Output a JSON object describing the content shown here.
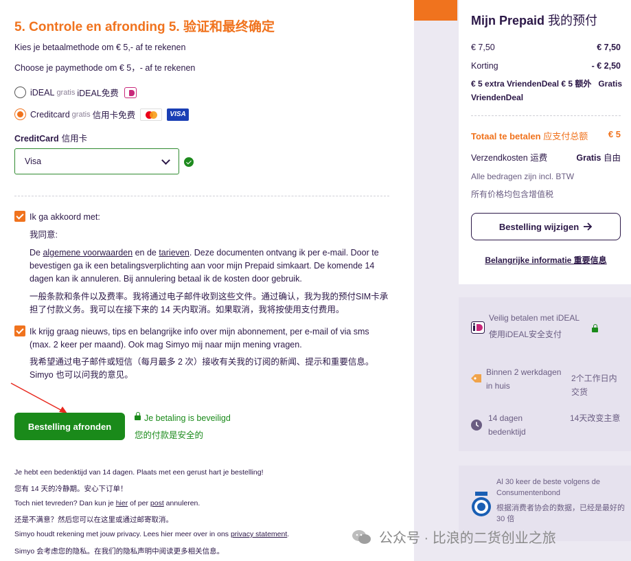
{
  "heading": "5. Controle en afronding 5. 验证和最终确定",
  "pay_nl": "Kies je betaalmethode om € 5,- af te rekenen",
  "pay_en": "Choose je paymethode om € 5，- af te rekenen",
  "methods": {
    "ideal": {
      "name": "iDEAL",
      "gratis": "gratis",
      "zh": "iDEAL免费"
    },
    "credit": {
      "name": "Creditcard",
      "gratis": "gratis",
      "zh": "信用卡免费",
      "visa": "VISA"
    }
  },
  "cc_label": "CreditCard",
  "cc_label_zh": "信用卡",
  "select_value": "Visa",
  "agree": {
    "title": "Ik ga akkoord met:",
    "title_zh": "我同意:",
    "pre": "De ",
    "link1": "algemene voorwaarden",
    "mid": " en de ",
    "link2": "tarieven",
    "body": ". Deze documenten ontvang ik per e-mail. Door te bevestigen ga ik een betalingsverplichting aan voor mijn Prepaid simkaart. De komende 14 dagen kan ik annuleren. Bij annulering betaal ik de kosten door gebruik.",
    "zh": "一般条款和条件以及费率。我将通过电子邮件收到这些文件。通过确认，我为我的预付SIM卡承担了付款义务。我可以在接下来的 14 天内取消。如果取消，我将按使用支付费用。"
  },
  "news": {
    "text": "Ik krijg graag nieuws, tips en belangrijke info over mijn abonnement, per e-mail of via sms (max. 2 keer per maand). Ook mag Simyo mij naar mijn mening vragen.",
    "zh": "我希望通过电子邮件或短信（每月最多 2 次）接收有关我的订阅的新闻、提示和重要信息。Simyo 也可以问我的意见。"
  },
  "finish_button": "Bestelling afronden",
  "secure_nl": "Je betaling is beveiligd",
  "secure_zh": "您的付款是安全的",
  "footer": {
    "l1": "Je hebt een bedenktijd van 14 dagen. Plaats met een gerust hart je bestelling!",
    "l2": "您有 14 天的冷静期。安心下订单！",
    "l3_pre": "Toch niet tevreden? Dan kun je ",
    "l3_link1": "hier",
    "l3_mid": " of per ",
    "l3_link2": "post",
    "l3_post": " annuleren.",
    "l4": "还是不满意？然后您可以在这里或通过邮寄取消。",
    "l5_pre": "Simyo houdt rekening met jouw privacy. Lees hier meer over in ons ",
    "l5_link": "privacy statement",
    "l5_post": ".",
    "l6": "Simyo 会考虑您的隐私。在我们的隐私声明中阅读更多相关信息。"
  },
  "summary": {
    "title": "Mijn Prepaid",
    "title_zh": "我的预付",
    "price_label": "€ 7,50",
    "price_value": "€ 7,50",
    "discount_label": "Korting",
    "discount_value": "- € 2,50",
    "deal": "€ 5 extra VriendenDeal € 5 额外 VriendenDeal",
    "deal_value": "Gratis",
    "total_label": "Totaal te betalen",
    "total_zh": "应支付总额",
    "total_value": "€ 5",
    "shipping_label": "Verzendkosten",
    "shipping_zh": "运费",
    "shipping_value": "Gratis",
    "shipping_value_zh": "自由",
    "btw": "Alle bedragen zijn incl. BTW",
    "btw_zh": "所有价格均包含增值税",
    "change_button": "Bestelling wijzigen",
    "info_link": "Belangrijke informatie 重要信息"
  },
  "features": [
    {
      "nl": "Veilig betalen met iDEAL",
      "zh": "使用iDEAL安全支付"
    },
    {
      "nl": "Binnen 2 werkdagen in huis",
      "zh": "2个工作日内交货"
    },
    {
      "nl": "14 dagen bedenktijd",
      "zh": "14天改变主意"
    }
  ],
  "rating": {
    "nl": "Al 30 keer de beste volgens de Consumentenbond",
    "zh": "根据消费者协会的数据，已经是最好的 30 倍"
  },
  "watermark": "公众号 · 比浪的二货创业之旅",
  "colors": {
    "orange": "#f0731e",
    "green": "#1a8a1a",
    "purple": "#2b1747",
    "panel": "#ece9f2"
  }
}
